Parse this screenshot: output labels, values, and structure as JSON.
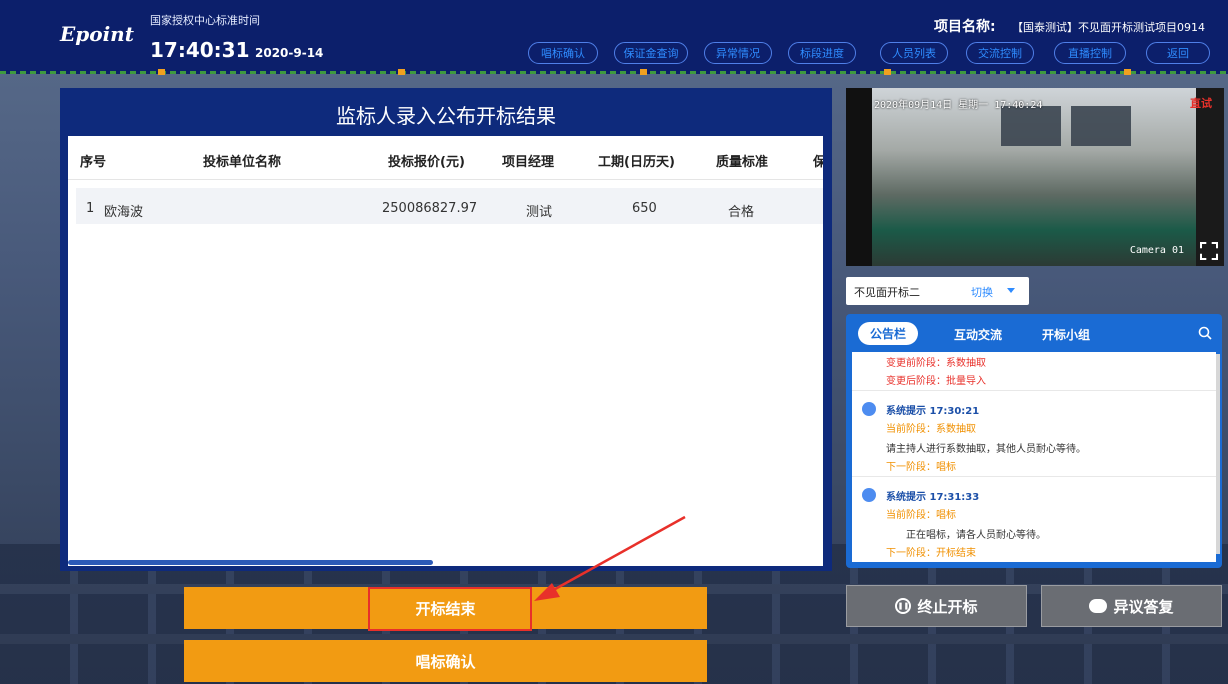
{
  "header": {
    "logo": "Epoint",
    "auth_label": "国家授权中心标准时间",
    "clock": "17:40:31",
    "date": "2020-9-14",
    "project_label": "项目名称:",
    "project_name": "【国泰测试】不见面开标测试项目0914",
    "nav": [
      "唱标确认",
      "保证金查询",
      "异常情况",
      "标段进度",
      "人员列表",
      "交流控制",
      "直播控制",
      "返回"
    ]
  },
  "main": {
    "title": "监标人录入公布开标结果",
    "columns": [
      "序号",
      "投标单位名称",
      "投标报价(元)",
      "项目经理",
      "工期(日历天)",
      "质量标准",
      "保"
    ],
    "rows": [
      {
        "index": "1",
        "bidder": "欧海波",
        "price": "250086827.97",
        "manager": "测试",
        "duration": "650",
        "quality": "合格"
      }
    ]
  },
  "buttons": {
    "finish_bidding": "开标结束",
    "confirm_bidding": "唱标确认",
    "stop_bidding": "终止开标",
    "objection_reply": "异议答复"
  },
  "video": {
    "osd": "2020年09月14日  星期一  17:40:24",
    "camera": "Camera 01",
    "rec": "直试"
  },
  "selector": {
    "value": "不见面开标二",
    "switch_label": "切换"
  },
  "bulletin": {
    "tabs": [
      "公告栏",
      "互动交流",
      "开标小组"
    ],
    "lines": {
      "before": "变更前阶段：系数抽取",
      "after": "变更后阶段：批量导入"
    },
    "messages": [
      {
        "title": "系统提示 17:30:21",
        "current": "当前阶段：系数抽取",
        "body": "请主持人进行系数抽取，其他人员耐心等待。",
        "next": "下一阶段：唱标"
      },
      {
        "title": "系统提示 17:31:33",
        "current": "当前阶段：唱标",
        "body": "正在唱标，请各人员耐心等待。",
        "next": "下一阶段：开标结束"
      }
    ]
  },
  "colors": {
    "header_bg": "#0c1f6b",
    "panel_bg": "#0e2a7c",
    "accent_orange": "#f29b12",
    "accent_blue": "#1a6bd4",
    "highlight_red": "#e8302a"
  }
}
